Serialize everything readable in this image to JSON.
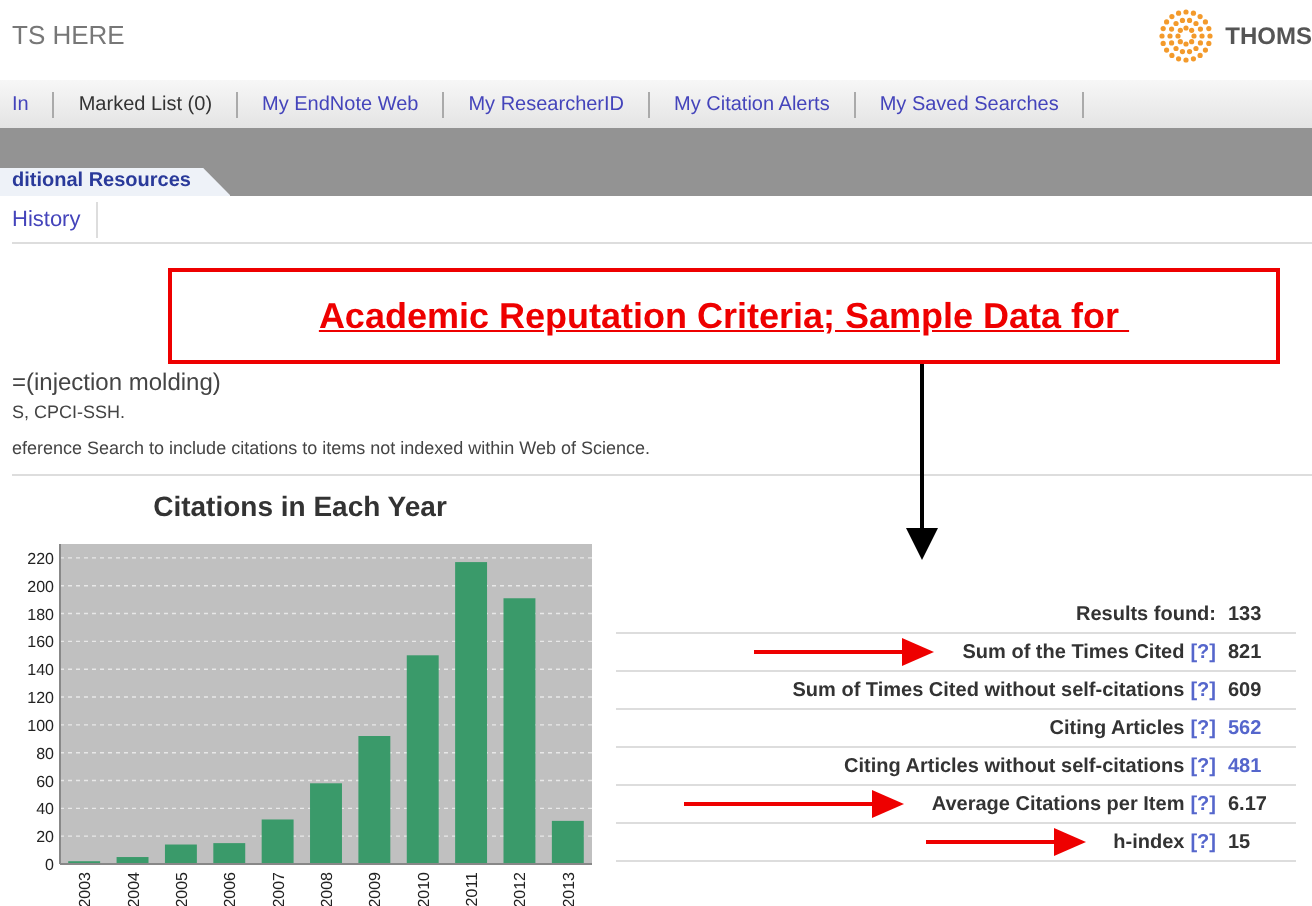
{
  "header": {
    "title": "TS HERE",
    "brand": "THOMS"
  },
  "nav": [
    {
      "label": "In",
      "link": true
    },
    {
      "label": "Marked List (0)",
      "link": false
    },
    {
      "label": "My EndNote Web",
      "link": true
    },
    {
      "label": "My ResearcherID",
      "link": true
    },
    {
      "label": "My Citation Alerts",
      "link": true
    },
    {
      "label": "My Saved Searches",
      "link": true
    }
  ],
  "tab": {
    "label": "ditional Resources"
  },
  "subnav": [
    "History"
  ],
  "callout": {
    "title": "Academic Reputation Criteria; Sample Data for "
  },
  "query": {
    "lines": [
      "=(injection molding)",
      "S, CPCI-SSH.",
      "eference Search to include citations to items not indexed within Web of Science."
    ]
  },
  "chart": {
    "chart_data": {
      "type": "bar",
      "title": "Citations in Each Year",
      "categories": [
        "2003",
        "2004",
        "2005",
        "2006",
        "2007",
        "2008",
        "2009",
        "2010",
        "2011",
        "2012",
        "2013"
      ],
      "values": [
        2,
        5,
        14,
        15,
        32,
        58,
        92,
        150,
        217,
        191,
        31
      ],
      "grid": true,
      "ylim": [
        0,
        230
      ],
      "yticks": [
        0,
        20,
        40,
        60,
        80,
        100,
        120,
        140,
        160,
        180,
        200,
        220
      ]
    }
  },
  "stats": [
    {
      "label": "Results found:",
      "value": "133",
      "link": false,
      "pointed": false
    },
    {
      "label": "Sum of the Times Cited",
      "help": "[?]",
      "value": "821",
      "link": false,
      "pointed": true
    },
    {
      "label": "Sum of Times Cited without self-citations",
      "help": "[?]",
      "value": "609",
      "link": false,
      "pointed": false
    },
    {
      "label": "Citing Articles",
      "help": "[?]",
      "value": "562",
      "link": true,
      "pointed": false
    },
    {
      "label": "Citing Articles without self-citations",
      "help": "[?]",
      "value": "481",
      "link": true,
      "pointed": false
    },
    {
      "label": "Average Citations per Item",
      "help": "[?]",
      "value": "6.17",
      "link": false,
      "pointed": true
    },
    {
      "label": "h-index",
      "help": "[?]",
      "value": "15",
      "link": false,
      "pointed": true
    }
  ]
}
